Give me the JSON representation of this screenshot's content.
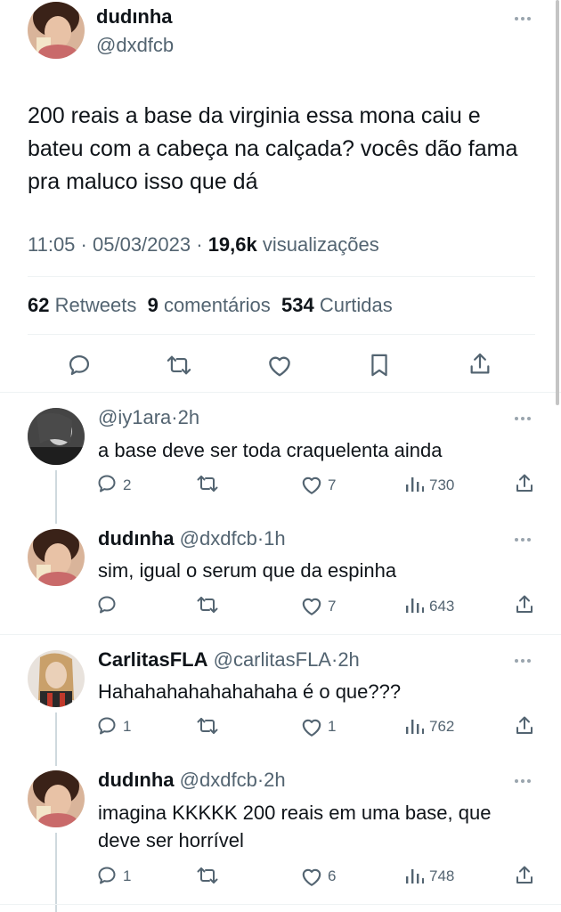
{
  "main_tweet": {
    "display_name": "dudınha",
    "handle": "@dxdfcb",
    "text": "200 reais a base da virginia essa mona caiu e bateu com a cabeça na calçada? vocês dão fama pra maluco isso que dá",
    "time": "11:05",
    "date": "05/03/2023",
    "views_count": "19,6k",
    "views_label": "visualizações",
    "retweets_count": "62",
    "retweets_label": "Retweets",
    "comments_count": "9",
    "comments_label": "comentários",
    "likes_count": "534",
    "likes_label": "Curtidas"
  },
  "replies": [
    {
      "display_name": "",
      "handle": "@iy1ara",
      "time": "2h",
      "text": "a base deve ser toda craquelenta ainda",
      "replies": "2",
      "retweets": "",
      "likes": "7",
      "views": "730"
    },
    {
      "display_name": "dudınha",
      "handle": "@dxdfcb",
      "time": "1h",
      "text": "sim, igual o serum que da espinha",
      "replies": "",
      "retweets": "",
      "likes": "7",
      "views": "643"
    },
    {
      "display_name": "CarlitasFLA",
      "handle": "@carlitasFLA",
      "time": "2h",
      "text": "Hahahahahahahahaha é o que???",
      "replies": "1",
      "retweets": "",
      "likes": "1",
      "views": "762"
    },
    {
      "display_name": "dudınha",
      "handle": "@dxdfcb",
      "time": "2h",
      "text": "imagina KKKKK 200 reais em uma base, que deve ser horrível",
      "replies": "1",
      "retweets": "",
      "likes": "6",
      "views": "748"
    }
  ],
  "icons": {
    "reply": "reply-icon",
    "retweet": "retweet-icon",
    "like": "heart-icon",
    "bookmark": "bookmark-icon",
    "share": "share-icon",
    "views": "views-icon",
    "more": "more-icon"
  },
  "colors": {
    "text": "#0f1419",
    "muted": "#536471",
    "divider": "#eff3f4"
  }
}
